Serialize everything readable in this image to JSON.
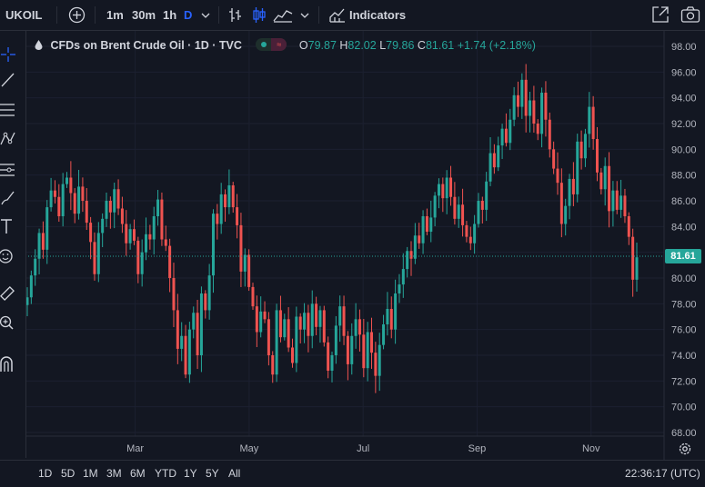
{
  "toolbar": {
    "symbol": "UKOIL",
    "intervals": [
      "1m",
      "30m",
      "1h",
      "D"
    ],
    "indicators_label": "Indicators"
  },
  "legend": {
    "title": "CFDs on Brent Crude Oil · 1D · TVC",
    "o_label": "O",
    "o": "79.87",
    "h_label": "H",
    "h": "82.02",
    "l_label": "L",
    "l": "79.86",
    "c_label": "C",
    "c": "81.61",
    "change": "+1.74 (+2.18%)"
  },
  "price_tag": "81.61",
  "bottom": {
    "ranges": [
      "1D",
      "5D",
      "1M",
      "3M",
      "6M",
      "YTD",
      "1Y",
      "5Y",
      "All"
    ],
    "clock": "22:36:17 (UTC)"
  },
  "colors": {
    "up": "#26a69a",
    "down": "#ef5350",
    "bg": "#131722",
    "accent": "#2962ff"
  },
  "icons": [
    "plus-circle-icon",
    "bar-style-icon",
    "candle-style-icon",
    "area-style-icon",
    "indicators-icon",
    "fullscreen-icon",
    "camera-icon",
    "settings-icon"
  ],
  "chart_data": {
    "type": "candlestick",
    "ylim": [
      68,
      98
    ],
    "yticks": [
      "98.00",
      "96.00",
      "94.00",
      "92.00",
      "90.00",
      "88.00",
      "86.00",
      "84.00",
      "82.00",
      "80.00",
      "78.00",
      "76.00",
      "74.00",
      "72.00",
      "70.00",
      "68.00"
    ],
    "xticks": [
      "Mar",
      "May",
      "Jul",
      "Sep",
      "Nov"
    ],
    "last_close": 81.61,
    "closes": [
      78.5,
      80.2,
      81.5,
      83.5,
      82.2,
      85.5,
      86.8,
      86.3,
      84.8,
      87.3,
      87.8,
      86.6,
      85.0,
      87.1,
      86.0,
      84.3,
      82.8,
      80.3,
      83.5,
      84.6,
      86.0,
      85.1,
      86.9,
      85.4,
      84.2,
      82.7,
      83.8,
      82.9,
      80.3,
      82.0,
      83.4,
      83.0,
      84.8,
      86.1,
      83.0,
      82.5,
      80.0,
      77.5,
      74.5,
      75.5,
      72.5,
      76.0,
      77.3,
      74.0,
      78.8,
      77.5,
      80.2,
      85.0,
      84.2,
      86.5,
      85.5,
      87.2,
      85.5,
      84.1,
      80.5,
      81.8,
      79.3,
      77.8,
      75.8,
      77.4,
      76.8,
      74.0,
      72.5,
      77.5,
      75.4,
      76.8,
      74.6,
      73.4,
      77.0,
      76.0,
      77.3,
      75.5,
      78.0,
      76.2,
      77.5,
      75.0,
      72.8,
      74.0,
      76.3,
      77.8,
      75.5,
      73.3,
      75.5,
      76.8,
      75.6,
      73.0,
      75.8,
      74.2,
      72.4,
      74.8,
      76.4,
      77.6,
      76.0,
      78.8,
      79.5,
      80.7,
      82.1,
      81.5,
      83.3,
      82.7,
      84.8,
      83.6,
      84.7,
      86.4,
      87.3,
      86.2,
      87.8,
      86.3,
      84.6,
      85.7,
      84.1,
      83.2,
      82.7,
      84.2,
      86.0,
      85.3,
      87.5,
      89.7,
      88.6,
      90.3,
      91.6,
      90.5,
      92.3,
      94.2,
      93.3,
      95.4,
      92.6,
      93.8,
      92.0,
      91.2,
      94.4,
      92.3,
      90.0,
      88.5,
      87.4,
      84.2,
      85.6,
      87.7,
      86.5,
      90.6,
      89.3,
      91.2,
      93.3,
      90.8,
      88.2,
      86.9,
      88.7,
      85.2,
      86.8,
      85.3,
      86.4,
      84.8,
      83.2,
      79.87,
      81.61
    ]
  }
}
